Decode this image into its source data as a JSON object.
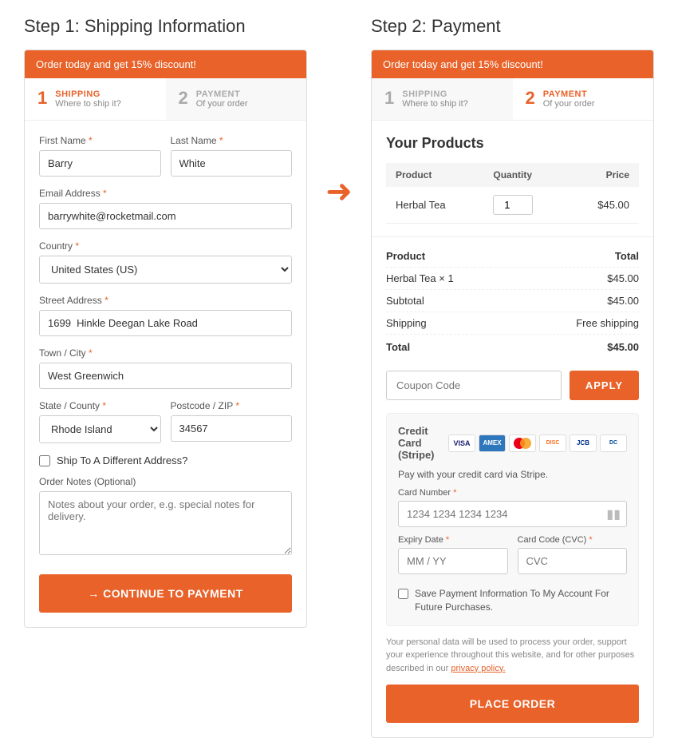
{
  "step1": {
    "title": "Step 1: Shipping Information",
    "promo": "Order today and get 15% discount!",
    "nav": {
      "step1_num": "1",
      "step1_label": "SHIPPING",
      "step1_sub": "Where to ship it?",
      "step2_num": "2",
      "step2_label": "PAYMENT",
      "step2_sub": "Of your order"
    },
    "form": {
      "first_name_label": "First Name",
      "first_name_value": "Barry",
      "last_name_label": "Last Name",
      "last_name_value": "White",
      "email_label": "Email Address",
      "email_value": "barrywhite@rocketmail.com",
      "country_label": "Country",
      "country_value": "United States (US)",
      "street_label": "Street Address",
      "street_value": "1699  Hinkle Deegan Lake Road",
      "city_label": "Town / City",
      "city_value": "West Greenwich",
      "state_label": "State / County",
      "state_value": "Rhode Island",
      "postcode_label": "Postcode / ZIP",
      "postcode_value": "34567",
      "ship_diff_label": "Ship To A Different Address?",
      "order_notes_label": "Order Notes (Optional)",
      "order_notes_placeholder": "Notes about your order, e.g. special notes for delivery.",
      "continue_btn": "→ CONTINUE TO PAYMENT"
    }
  },
  "step2": {
    "title": "Step 2: Payment",
    "promo": "Order today and get 15% discount!",
    "nav": {
      "step1_num": "1",
      "step1_label": "SHIPPING",
      "step1_sub": "Where to ship it?",
      "step2_num": "2",
      "step2_label": "PAYMENT",
      "step2_sub": "Of your order"
    },
    "products_title": "Your Products",
    "table": {
      "headers": [
        "Product",
        "Quantity",
        "Price"
      ],
      "rows": [
        {
          "product": "Herbal Tea",
          "quantity": "1",
          "price": "$45.00"
        }
      ]
    },
    "summary": {
      "header_product": "Product",
      "header_total": "Total",
      "rows": [
        {
          "label": "Herbal Tea × 1",
          "value": "$45.00"
        },
        {
          "label": "Subtotal",
          "value": "$45.00"
        },
        {
          "label": "Shipping",
          "value": "Free shipping"
        },
        {
          "label": "Total",
          "value": "$45.00",
          "bold": true
        }
      ]
    },
    "coupon": {
      "placeholder": "Coupon Code",
      "button": "APPLY"
    },
    "payment": {
      "cc_label": "Credit Card (Stripe)",
      "stripe_note": "Pay with your credit card via Stripe.",
      "card_number_label": "Card Number",
      "card_number_placeholder": "1234 1234 1234 1234",
      "expiry_label": "Expiry Date",
      "expiry_placeholder": "MM / YY",
      "cvc_label": "Card Code (CVC)",
      "cvc_placeholder": "CVC",
      "save_label": "Save Payment Information To My Account For Future Purchases.",
      "privacy_text": "Your personal data will be used to process your order, support your experience throughout this website, and for other purposes described in our",
      "privacy_link": "privacy policy.",
      "place_order_btn": "PLACE ORDER"
    }
  }
}
